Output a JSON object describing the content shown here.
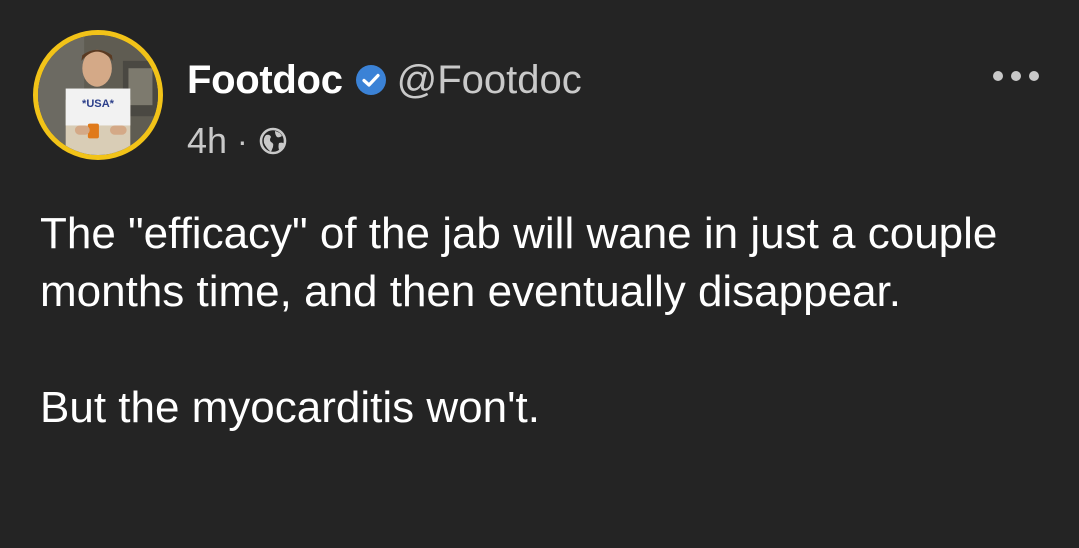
{
  "post": {
    "author": {
      "display_name": "Footdoc",
      "handle": "@Footdoc",
      "verified": true,
      "avatar_border_color": "#f2c318",
      "verified_color": "#3b82d6"
    },
    "timestamp": "4h",
    "separator": "·",
    "visibility_icon": "globe-icon",
    "more_icon": "more-horizontal-icon",
    "paragraphs": [
      "The \"efficacy\" of the jab will wane in just a couple months time, and then eventually disappear.",
      "But the myocarditis won't."
    ]
  },
  "theme": {
    "background": "#242424",
    "text": "#ffffff",
    "secondary_text": "#c9c9c9"
  }
}
